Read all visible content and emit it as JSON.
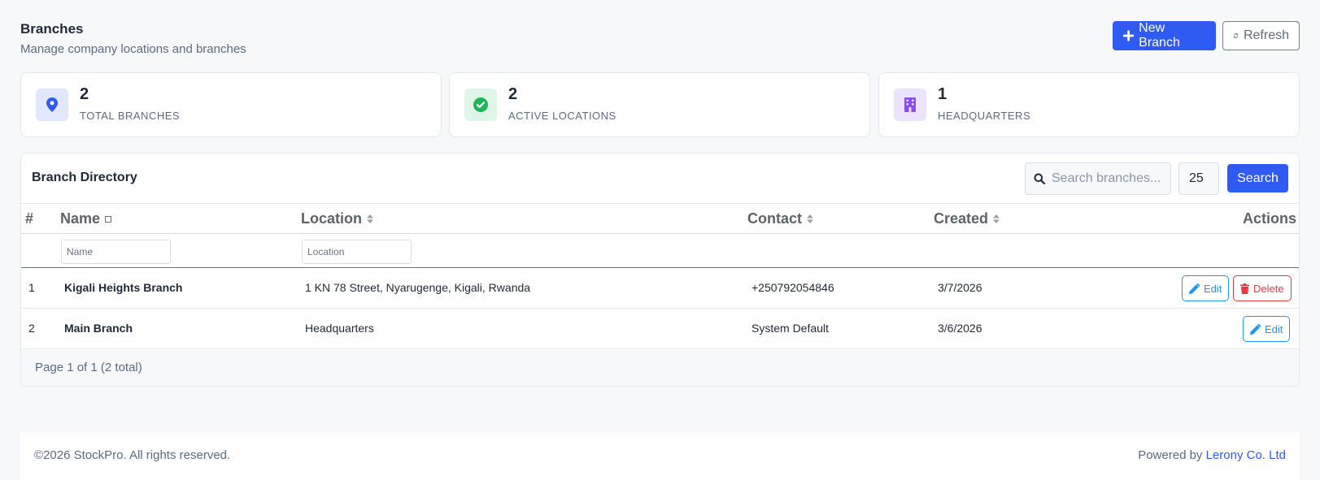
{
  "header": {
    "title": "Branches",
    "subtitle": "Manage company locations and branches",
    "new_button": "New Branch",
    "refresh_button": "Refresh"
  },
  "stats": [
    {
      "value": "2",
      "label": "TOTAL BRANCHES",
      "icon": "map-pin-icon",
      "icon_color": "#2f5bf2",
      "icon_bg": "#e1e8fd"
    },
    {
      "value": "2",
      "label": "ACTIVE LOCATIONS",
      "icon": "check-circle-icon",
      "icon_color": "#1fb55a",
      "icon_bg": "#dff5e8"
    },
    {
      "value": "1",
      "label": "HEADQUARTERS",
      "icon": "building-icon",
      "icon_color": "#8b4cf0",
      "icon_bg": "#ece3fd"
    }
  ],
  "directory": {
    "title": "Branch Directory",
    "search_placeholder": "Search branches...",
    "page_size": "25",
    "search_button": "Search"
  },
  "table": {
    "columns": {
      "num": "#",
      "name": "Name",
      "location": "Location",
      "contact": "Contact",
      "created": "Created",
      "actions": "Actions"
    },
    "filters": {
      "name_placeholder": "Name",
      "location_placeholder": "Location"
    },
    "rows": [
      {
        "num": "1",
        "name": "Kigali Heights Branch",
        "location": "1 KN 78 Street, Nyarugenge, Kigali, Rwanda",
        "contact": "+250792054846",
        "created": "3/7/2026",
        "edit": "Edit",
        "delete": "Delete"
      },
      {
        "num": "2",
        "name": "Main Branch",
        "location": "Headquarters",
        "contact": "System Default",
        "created": "3/6/2026",
        "edit": "Edit"
      }
    ],
    "pager": "Page 1 of 1 (2 total)"
  },
  "footer": {
    "copyright": "©2026 StockPro. All rights reserved.",
    "powered_by": "Powered by ",
    "company": "Lerony Co. Ltd"
  },
  "colors": {
    "primary": "#2f5bf2",
    "edit": "#2196f3",
    "delete": "#e53945"
  }
}
